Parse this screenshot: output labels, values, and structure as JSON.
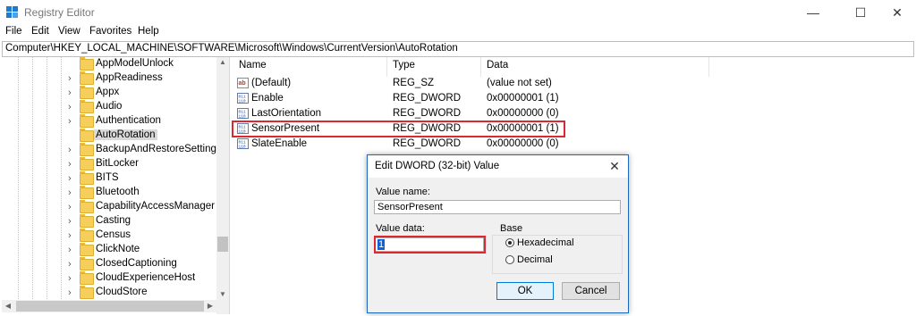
{
  "window": {
    "title": "Registry Editor"
  },
  "menu": [
    "File",
    "Edit",
    "View",
    "Favorites",
    "Help"
  ],
  "address": "Computer\\HKEY_LOCAL_MACHINE\\SOFTWARE\\Microsoft\\Windows\\CurrentVersion\\AutoRotation",
  "tree": {
    "items": [
      {
        "label": "AppModelUnlock",
        "expandable": false
      },
      {
        "label": "AppReadiness",
        "expandable": true
      },
      {
        "label": "Appx",
        "expandable": true
      },
      {
        "label": "Audio",
        "expandable": true
      },
      {
        "label": "Authentication",
        "expandable": true
      },
      {
        "label": "AutoRotation",
        "expandable": false,
        "selected": true
      },
      {
        "label": "BackupAndRestoreSettings",
        "expandable": true
      },
      {
        "label": "BitLocker",
        "expandable": true
      },
      {
        "label": "BITS",
        "expandable": true
      },
      {
        "label": "Bluetooth",
        "expandable": true
      },
      {
        "label": "CapabilityAccessManager",
        "expandable": true
      },
      {
        "label": "Casting",
        "expandable": true
      },
      {
        "label": "Census",
        "expandable": true
      },
      {
        "label": "ClickNote",
        "expandable": true
      },
      {
        "label": "ClosedCaptioning",
        "expandable": true
      },
      {
        "label": "CloudExperienceHost",
        "expandable": true
      },
      {
        "label": "CloudStore",
        "expandable": true
      }
    ]
  },
  "list": {
    "columns": [
      "Name",
      "Type",
      "Data"
    ],
    "rows": [
      {
        "name": "(Default)",
        "type": "REG_SZ",
        "data": "(value not set)",
        "icon": "string-value-icon"
      },
      {
        "name": "Enable",
        "type": "REG_DWORD",
        "data": "0x00000001 (1)",
        "icon": "binary-value-icon"
      },
      {
        "name": "LastOrientation",
        "type": "REG_DWORD",
        "data": "0x00000000 (0)",
        "icon": "binary-value-icon"
      },
      {
        "name": "SensorPresent",
        "type": "REG_DWORD",
        "data": "0x00000001 (1)",
        "icon": "binary-value-icon"
      },
      {
        "name": "SlateEnable",
        "type": "REG_DWORD",
        "data": "0x00000000 (0)",
        "icon": "binary-value-icon"
      }
    ]
  },
  "dialog": {
    "title": "Edit DWORD (32-bit) Value",
    "value_name_label": "Value name:",
    "value_name": "SensorPresent",
    "value_data_label": "Value data:",
    "value_data": "1",
    "base_label": "Base",
    "radix_options": [
      {
        "label": "Hexadecimal",
        "selected": true
      },
      {
        "label": "Decimal",
        "selected": false
      }
    ],
    "ok_label": "OK",
    "cancel_label": "Cancel"
  },
  "colors": {
    "highlight_red": "#e0262f",
    "dialog_border": "#1c67c0",
    "folder": "#f5cf5a"
  }
}
